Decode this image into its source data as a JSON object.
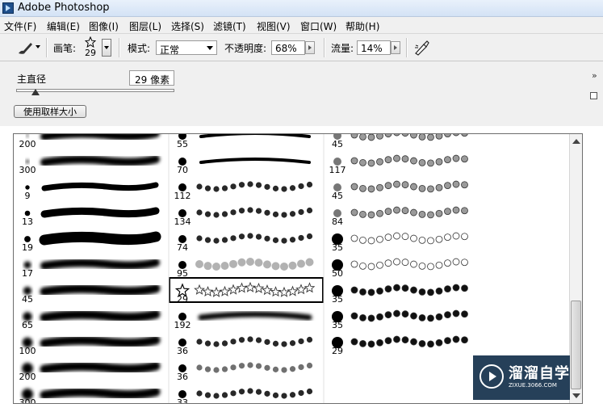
{
  "titlebar": {
    "title": "Adobe Photoshop"
  },
  "menu": [
    {
      "label": "文件(F)"
    },
    {
      "label": "编辑(E)"
    },
    {
      "label": "图像(I)"
    },
    {
      "label": "图层(L)"
    },
    {
      "label": "选择(S)"
    },
    {
      "label": "滤镜(T)"
    },
    {
      "label": "视图(V)"
    },
    {
      "label": "窗口(W)"
    },
    {
      "label": "帮助(H)"
    }
  ],
  "options": {
    "brush_label": "画笔:",
    "brush_size": "29",
    "mode_label": "模式:",
    "mode_value": "正常",
    "opacity_label": "不透明度:",
    "opacity_value": "68%",
    "flow_label": "流量:",
    "flow_value": "14%"
  },
  "panel": {
    "diameter_label": "主直径",
    "diameter_value": "29 像素",
    "diameter_fraction": 0.12,
    "sample_button": "使用取样大小",
    "expand_glyph": "»"
  },
  "brushes": {
    "columns": [
      {
        "sizes": [
          "200",
          "300",
          "9",
          "13",
          "19",
          "17",
          "45",
          "65",
          "100",
          "200",
          "300"
        ]
      },
      {
        "sizes": [
          "55",
          "70",
          "112",
          "134",
          "74",
          "95",
          "29",
          "192",
          "36",
          "36",
          "33"
        ],
        "selected_index": 6
      },
      {
        "sizes": [
          "45",
          "117",
          "45",
          "84",
          "35",
          "50",
          "35",
          "35",
          "29"
        ]
      }
    ]
  },
  "watermark": {
    "title": "溜溜自学",
    "url": "ZIXUE.3066.COM"
  }
}
